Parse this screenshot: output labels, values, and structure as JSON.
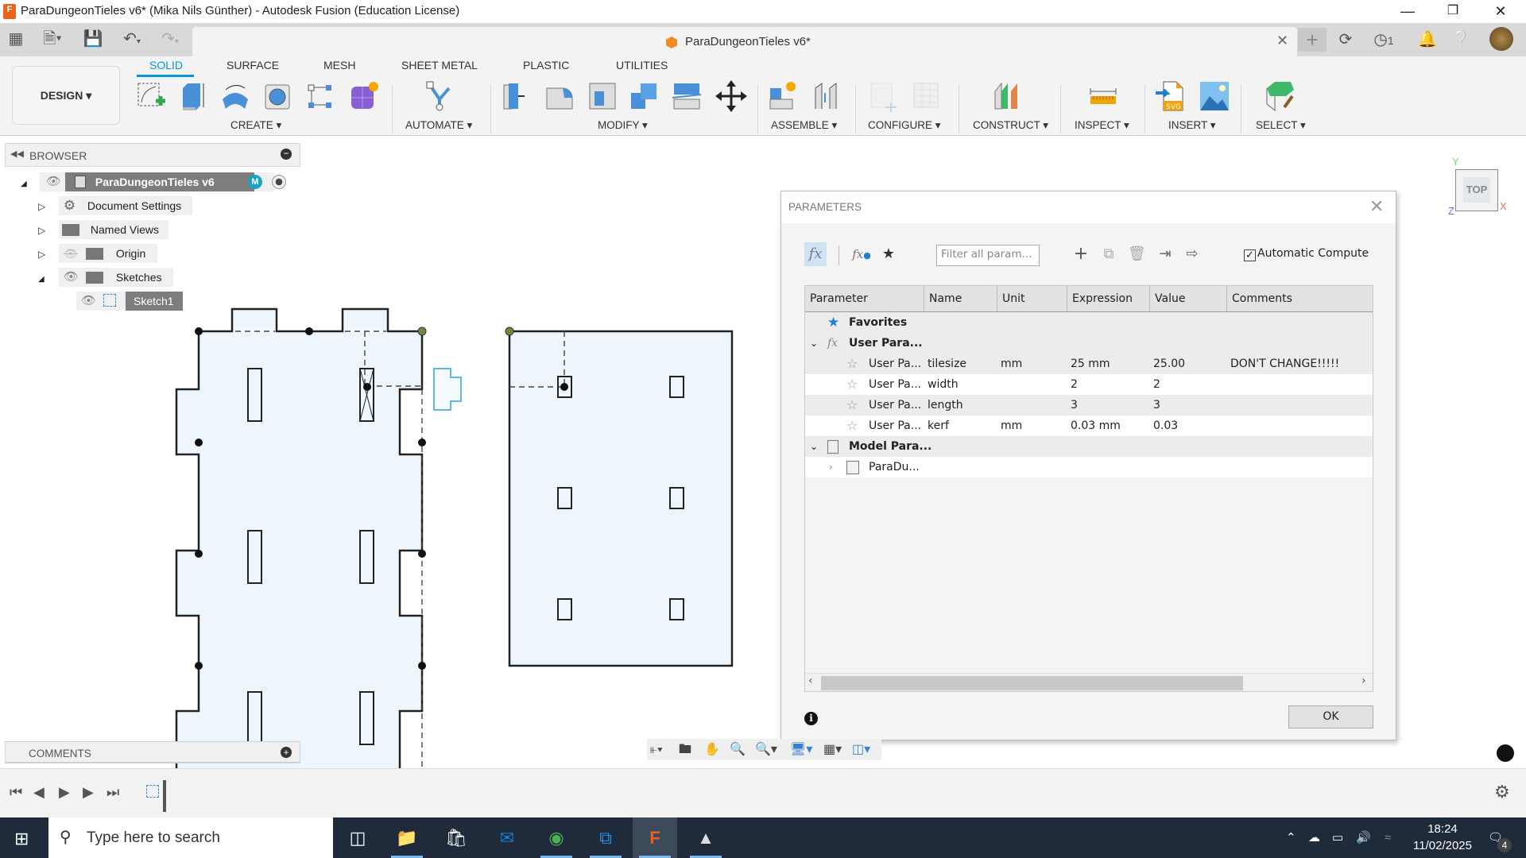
{
  "window": {
    "title": "ParaDungeonTieles v6* (Mika Nils Günther) - Autodesk Fusion (Education License)",
    "app_icon": "fusion-icon",
    "controls": [
      "minimize",
      "restore",
      "close"
    ]
  },
  "tabbar": {
    "doc_tab_label": "ParaDungeonTieles v6*",
    "job_count": "1"
  },
  "toolbar": {
    "workspace": "DESIGN ▾",
    "tabs": [
      "SOLID",
      "SURFACE",
      "MESH",
      "SHEET METAL",
      "PLASTIC",
      "UTILITIES"
    ],
    "active_tab": "SOLID",
    "groups": {
      "create": "CREATE ▾",
      "automate": "AUTOMATE ▾",
      "modify": "MODIFY ▾",
      "assemble": "ASSEMBLE ▾",
      "configure": "CONFIGURE ▾",
      "construct": "CONSTRUCT ▾",
      "inspect": "INSPECT ▾",
      "insert": "INSERT ▾",
      "select": "SELECT ▾"
    }
  },
  "browser": {
    "header": "BROWSER",
    "root": "ParaDungeonTieles v6",
    "items": [
      {
        "label": "Document Settings",
        "icon": "gear-icon"
      },
      {
        "label": "Named Views",
        "icon": "folder-icon"
      },
      {
        "label": "Origin",
        "icon": "folder-icon"
      },
      {
        "label": "Sketches",
        "icon": "folder-icon"
      },
      {
        "label": "Sketch1",
        "icon": "sketch-icon"
      }
    ]
  },
  "viewcube": {
    "face": "TOP",
    "axes": {
      "x": "X",
      "y": "Y",
      "z": "Z"
    }
  },
  "parameters_dialog": {
    "title": "PARAMETERS",
    "filter_placeholder": "Filter all param...",
    "automatic_compute_label": "Automatic Compute",
    "automatic_compute_checked": true,
    "columns": [
      "Parameter",
      "Name",
      "Unit",
      "Expression",
      "Value",
      "Comments"
    ],
    "groups": {
      "favorites": "Favorites",
      "user": "User Para...",
      "model": "Model Para...",
      "model_child": "ParaDu..."
    },
    "rows": [
      {
        "parameter": "User Pa...",
        "name": "tilesize",
        "unit": "mm",
        "expression": "25 mm",
        "value": "25.00",
        "comments": "DON'T CHANGE!!!!!"
      },
      {
        "parameter": "User Pa...",
        "name": "width",
        "unit": "",
        "expression": "2",
        "value": "2",
        "comments": ""
      },
      {
        "parameter": "User Pa...",
        "name": "length",
        "unit": "",
        "expression": "3",
        "value": "3",
        "comments": ""
      },
      {
        "parameter": "User Pa...",
        "name": "kerf",
        "unit": "mm",
        "expression": "0.03 mm",
        "value": "0.03",
        "comments": ""
      }
    ],
    "ok_label": "OK"
  },
  "comments": {
    "label": "COMMENTS"
  },
  "taskbar": {
    "search_placeholder": "Type here to search",
    "time": "18:24",
    "date": "11/02/2025",
    "notifications": "4"
  }
}
